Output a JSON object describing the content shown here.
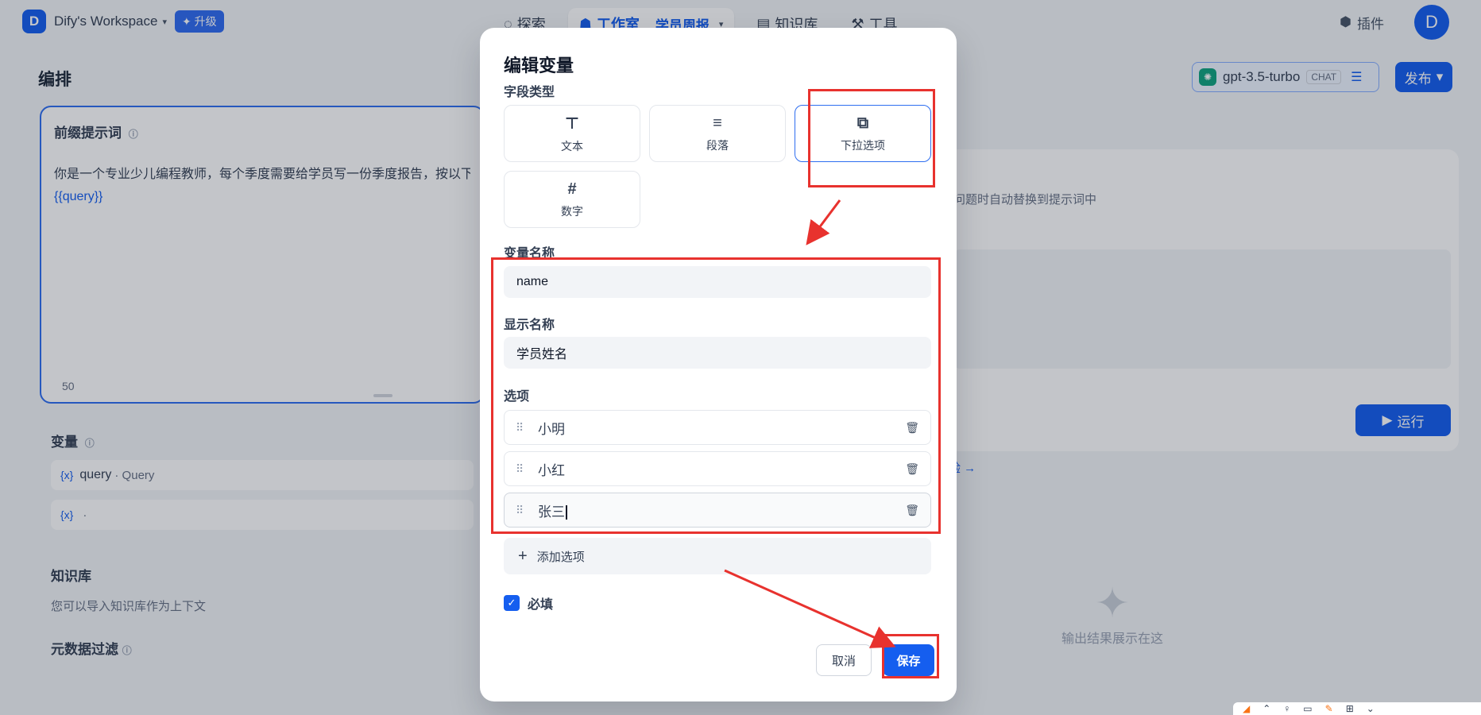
{
  "topnav": {
    "workspace_initial": "D",
    "workspace_name": "Dify's Workspace",
    "upgrade_label": "✦ 升级",
    "nav": {
      "explore": "探索",
      "studio": "工作室",
      "studio_sub": "学员周报",
      "knowledge": "知识库",
      "tools": "工具"
    },
    "plugins_label": "插件",
    "avatar_initial": "D"
  },
  "left": {
    "page_title": "编排",
    "prompt": {
      "title": "前缀提示词",
      "text": "你是一个专业少儿编程教师，每个季度需要给学员写一份季度报告，按以下",
      "variable": "{{query}}",
      "count": "50"
    },
    "variables": {
      "title": "变量",
      "rows": [
        {
          "icon": "{x}",
          "key": "query",
          "label": "· Query"
        },
        {
          "icon": "{x}",
          "key": "",
          "label": "·"
        }
      ]
    },
    "knowledge": {
      "title": "知识库",
      "desc": "您可以导入知识库作为上下文",
      "metadata_title": "元数据过滤"
    }
  },
  "right": {
    "model_name": "gpt-3.5-turbo",
    "model_badge": "CHAT",
    "publish_label": "发布",
    "debug_hint": "问题时自动替换到提示词中",
    "run_label": "运行",
    "link_text": "验 →",
    "output_empty": "输出结果展示在这"
  },
  "dialog": {
    "title": "编辑变量",
    "field_type_label": "字段类型",
    "types": [
      {
        "icon": "T",
        "name": "文本"
      },
      {
        "icon": "≡",
        "name": "段落"
      },
      {
        "icon": "☑",
        "name": "下拉选项"
      },
      {
        "icon": "#",
        "name": "数字"
      }
    ],
    "selected_type": "下拉选项",
    "var_name_label": "变量名称",
    "var_name_value": "name",
    "display_name_label": "显示名称",
    "display_name_value": "学员姓名",
    "options_label": "选项",
    "options": [
      "小明",
      "小红",
      "张三"
    ],
    "add_option_label": "添加选项",
    "required_label": "必填",
    "required_checked": true,
    "cancel_label": "取消",
    "save_label": "保存"
  },
  "colors": {
    "primary": "#155eef",
    "annotation_red": "#e8322e"
  }
}
